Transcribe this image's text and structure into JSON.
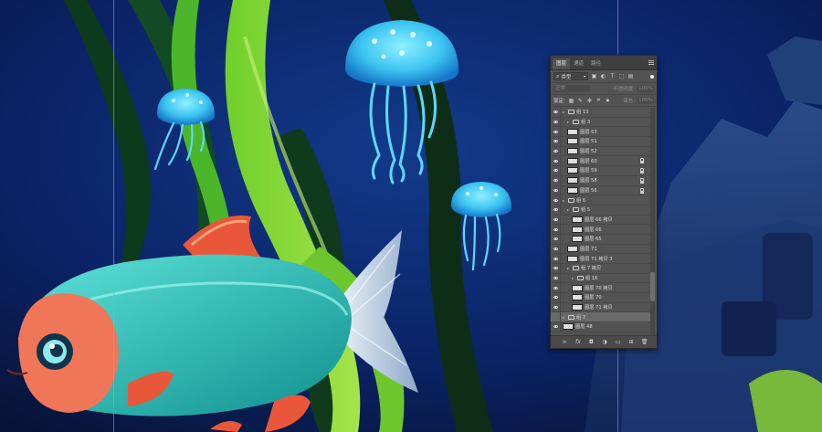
{
  "panel": {
    "tabs": [
      {
        "label": "图层",
        "active": true
      },
      {
        "label": "通道",
        "active": false
      },
      {
        "label": "路径",
        "active": false
      }
    ],
    "filter_type": "类型",
    "blend_mode": "正常",
    "opacity_label": "不透明度:",
    "opacity_value": "100%",
    "lock_label": "锁定:",
    "fill_label": "填充:",
    "fill_value": "100%"
  },
  "layers": [
    {
      "name": "组 13",
      "kind": "group",
      "visible": true,
      "locked": false,
      "indent": 0
    },
    {
      "name": "组 3",
      "kind": "group",
      "visible": true,
      "locked": false,
      "indent": 1
    },
    {
      "name": "图层 53",
      "kind": "layer",
      "visible": true,
      "locked": false,
      "indent": 1
    },
    {
      "name": "图层 51",
      "kind": "layer",
      "visible": true,
      "locked": false,
      "indent": 1
    },
    {
      "name": "图层 52",
      "kind": "layer",
      "visible": true,
      "locked": false,
      "indent": 1
    },
    {
      "name": "图层 60",
      "kind": "layer",
      "visible": true,
      "locked": true,
      "indent": 1
    },
    {
      "name": "图层 59",
      "kind": "layer",
      "visible": true,
      "locked": true,
      "indent": 1
    },
    {
      "name": "图层 58",
      "kind": "layer",
      "visible": true,
      "locked": true,
      "indent": 1
    },
    {
      "name": "图层 56",
      "kind": "layer",
      "visible": true,
      "locked": true,
      "indent": 1
    },
    {
      "name": "组 6",
      "kind": "group",
      "visible": true,
      "locked": false,
      "indent": 0
    },
    {
      "name": "组 5",
      "kind": "group",
      "visible": true,
      "locked": false,
      "indent": 1
    },
    {
      "name": "图层 66 拷贝",
      "kind": "layer",
      "visible": true,
      "locked": false,
      "indent": 2
    },
    {
      "name": "图层 66",
      "kind": "layer",
      "visible": true,
      "locked": false,
      "indent": 2
    },
    {
      "name": "图层 65",
      "kind": "layer",
      "visible": true,
      "locked": false,
      "indent": 2
    },
    {
      "name": "图层 71",
      "kind": "layer",
      "visible": true,
      "locked": false,
      "indent": 1
    },
    {
      "name": "图层 71 拷贝 3",
      "kind": "layer",
      "visible": true,
      "locked": false,
      "indent": 1
    },
    {
      "name": "组 7 拷贝",
      "kind": "group",
      "visible": true,
      "locked": false,
      "indent": 1
    },
    {
      "name": "组 16",
      "kind": "group",
      "visible": true,
      "locked": false,
      "indent": 2
    },
    {
      "name": "图层 70 拷贝",
      "kind": "layer",
      "visible": true,
      "locked": false,
      "indent": 2
    },
    {
      "name": "图层 70",
      "kind": "layer",
      "visible": true,
      "locked": false,
      "indent": 2
    },
    {
      "name": "图层 71 拷贝",
      "kind": "layer",
      "visible": true,
      "locked": false,
      "indent": 2
    },
    {
      "name": "组 7",
      "kind": "group",
      "visible": false,
      "locked": false,
      "indent": 0,
      "selected": true
    },
    {
      "name": "图层 48",
      "kind": "layer",
      "visible": true,
      "locked": false,
      "indent": 0
    }
  ],
  "scroll_position": 0.82,
  "colors": {
    "background": "#0a1a44",
    "fish_body": "#2fc6c0",
    "fish_head": "#f0765a",
    "fin": "#e9573a",
    "jelly": "#3ec8f2",
    "seaweed_dark": "#0f3a1e",
    "seaweed_light": "#8fd53a",
    "guide": "#b98cff"
  },
  "icons": {
    "filter": "search-icon",
    "menu": "panel-menu-icon",
    "eye": "eye-icon",
    "lock": "lock-icon",
    "folder": "folder-icon"
  }
}
